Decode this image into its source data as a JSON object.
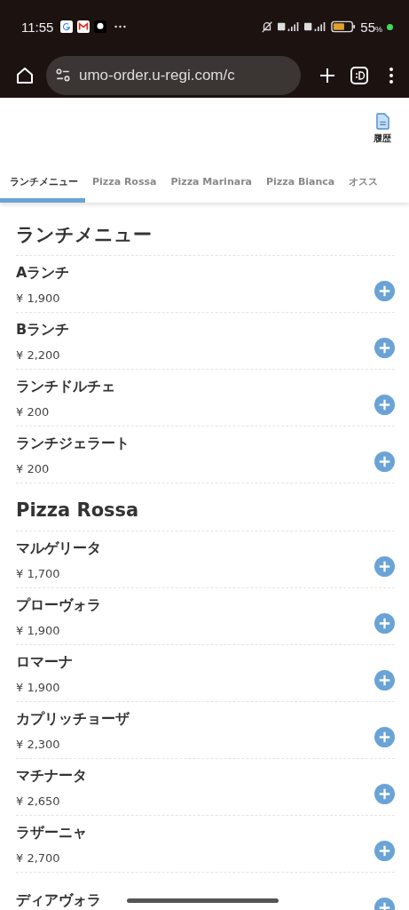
{
  "status_bar": {
    "time": "11:55",
    "battery": "55",
    "battery_unit": "%"
  },
  "browser": {
    "url": "umo-order.u-regi.com/c"
  },
  "header": {
    "history_label": "履歴"
  },
  "tabs": [
    {
      "label": "ランチメニュー",
      "selected": true
    },
    {
      "label": "Pizza Rossa",
      "selected": false
    },
    {
      "label": "Pizza Marinara",
      "selected": false
    },
    {
      "label": "Pizza Bianca",
      "selected": false
    },
    {
      "label": "オスス",
      "selected": false
    }
  ],
  "sections": [
    {
      "title": "ランチメニュー",
      "items": [
        {
          "name": "Aランチ",
          "price": "¥ 1,900"
        },
        {
          "name": "Bランチ",
          "price": "¥ 2,200"
        },
        {
          "name": "ランチドルチェ",
          "price": "¥ 200"
        },
        {
          "name": "ランチジェラート",
          "price": "¥ 200"
        }
      ]
    },
    {
      "title": "Pizza Rossa",
      "items": [
        {
          "name": "マルゲリータ",
          "price": "¥ 1,700"
        },
        {
          "name": "プローヴォラ",
          "price": "¥ 1,900"
        },
        {
          "name": "ロマーナ",
          "price": "¥ 1,900"
        },
        {
          "name": "カプリッチョーザ",
          "price": "¥ 2,300"
        },
        {
          "name": "マチナータ",
          "price": "¥ 2,650"
        },
        {
          "name": "ラザーニャ",
          "price": "¥ 2,700"
        },
        {
          "name": "ディアヴォラ"
        }
      ]
    }
  ]
}
